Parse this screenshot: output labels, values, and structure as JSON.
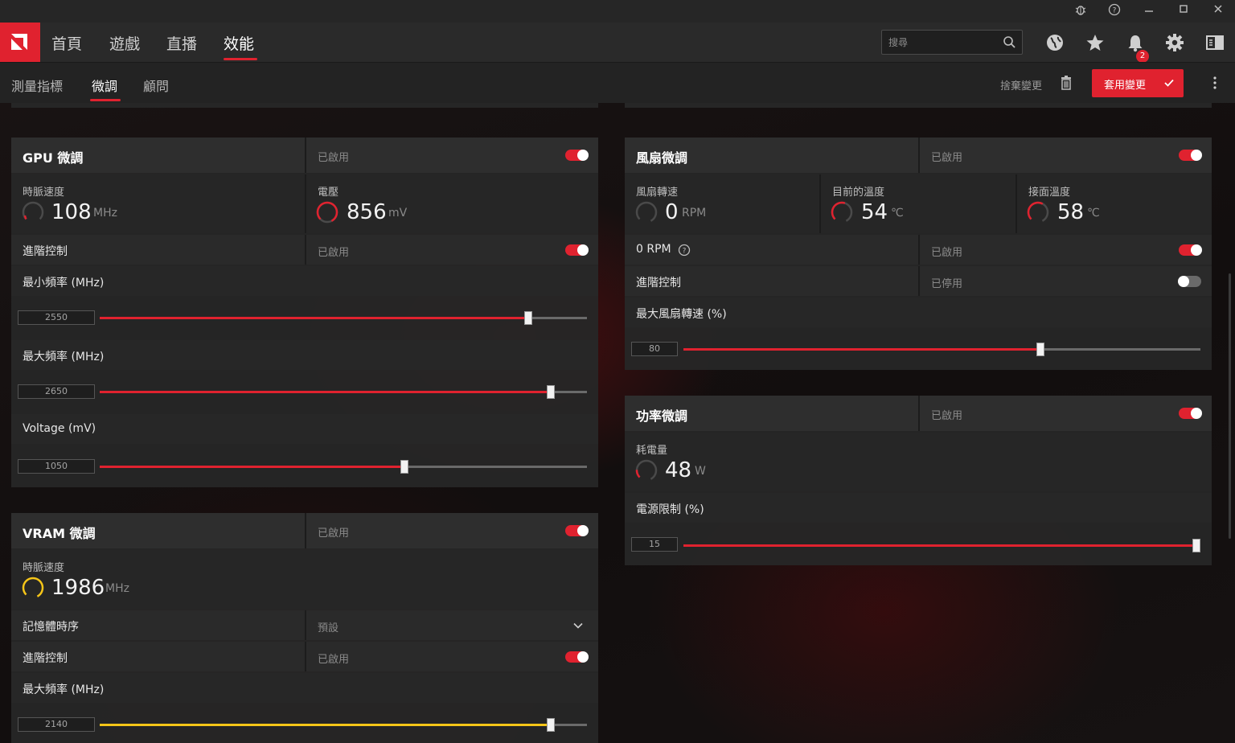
{
  "nav": {
    "tabs": [
      "首頁",
      "遊戲",
      "直播",
      "效能"
    ],
    "active_tab": "效能",
    "search_placeholder": "搜尋",
    "notification_count": "2"
  },
  "subnav": {
    "tabs": [
      "測量指標",
      "微調",
      "顧問"
    ],
    "active_tab": "微調",
    "discard_label": "捨棄變更",
    "apply_label": "套用變更"
  },
  "colors": {
    "accent": "#e0222f",
    "vram_accent": "#f5c518"
  },
  "gpu": {
    "title": "GPU 微調",
    "status": "已啟用",
    "clock_label": "時脈速度",
    "clock_value": "108",
    "clock_unit": "MHz",
    "voltage_label": "電壓",
    "voltage_value": "856",
    "voltage_unit": "mV",
    "advanced_label": "進階控制",
    "advanced_status": "已啟用",
    "min_freq_label": "最小頻率 (MHz)",
    "min_freq_value": "2550",
    "min_freq_fraction": 0.88,
    "max_freq_label": "最大頻率 (MHz)",
    "max_freq_value": "2650",
    "max_freq_fraction": 0.925,
    "voltage_slider_label": "Voltage (mV)",
    "voltage_slider_value": "1050",
    "voltage_slider_fraction": 0.625
  },
  "vram": {
    "title": "VRAM 微調",
    "status": "已啟用",
    "clock_label": "時脈速度",
    "clock_value": "1986",
    "clock_unit": "MHz",
    "timing_label": "記憶體時序",
    "timing_value": "預設",
    "advanced_label": "進階控制",
    "advanced_status": "已啟用",
    "max_freq_label": "最大頻率 (MHz)",
    "max_freq_value": "2140",
    "max_freq_fraction": 0.925
  },
  "fan": {
    "title": "風扇微調",
    "status": "已啟用",
    "speed_label": "風扇轉速",
    "speed_value": "0",
    "speed_unit": "RPM",
    "temp_label": "目前的溫度",
    "temp_value": "54",
    "temp_unit": "℃",
    "junction_label": "接面溫度",
    "junction_value": "58",
    "junction_unit": "℃",
    "zero_rpm_label": "0 RPM",
    "zero_rpm_status": "已啟用",
    "advanced_label": "進階控制",
    "advanced_status": "已停用",
    "max_speed_label": "最大風扇轉速 (%)",
    "max_speed_value": "80",
    "max_speed_fraction": 0.69
  },
  "power": {
    "title": "功率微調",
    "status": "已啟用",
    "consumption_label": "耗電量",
    "consumption_value": "48",
    "consumption_unit": "W",
    "limit_label": "電源限制 (%)",
    "limit_value": "15",
    "limit_fraction": 1.0
  }
}
